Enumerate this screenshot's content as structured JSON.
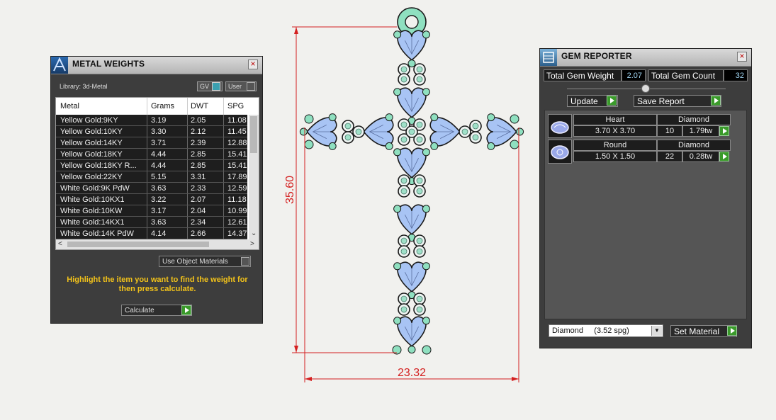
{
  "metal_weights": {
    "title": "METAL WEIGHTS",
    "library_label": "Library: 3d-Metal",
    "gv_label": "GV",
    "user_label": "User",
    "columns": [
      "Metal",
      "Grams",
      "DWT",
      "SPG"
    ],
    "rows": [
      [
        "Yellow Gold:9KY",
        "3.19",
        "2.05",
        "11.08"
      ],
      [
        "Yellow Gold:10KY",
        "3.30",
        "2.12",
        "11.45"
      ],
      [
        "Yellow Gold:14KY",
        "3.71",
        "2.39",
        "12.88"
      ],
      [
        "Yellow Gold:18KY",
        "4.44",
        "2.85",
        "15.41"
      ],
      [
        "Yellow Gold:18KY R...",
        "4.44",
        "2.85",
        "15.41"
      ],
      [
        "Yellow Gold:22KY",
        "5.15",
        "3.31",
        "17.89"
      ],
      [
        "White Gold:9K PdW",
        "3.63",
        "2.33",
        "12.59"
      ],
      [
        "White Gold:10KX1",
        "3.22",
        "2.07",
        "11.18"
      ],
      [
        "White Gold:10KW",
        "3.17",
        "2.04",
        "10.99"
      ],
      [
        "White Gold:14KX1",
        "3.63",
        "2.34",
        "12.61"
      ],
      [
        "White Gold:14K PdW",
        "4.14",
        "2.66",
        "14.37"
      ]
    ],
    "use_object_materials": "Use Object Materials",
    "hint": "Highlight the item you want to find the weight for then press calculate.",
    "calculate_label": "Calculate"
  },
  "drawing": {
    "height_label": "35.60",
    "width_label": "23.32",
    "colors": {
      "dimension": "#d42020",
      "heart_fill": "#a8c4f4",
      "accent_fill": "#8fe0c0",
      "outline": "#1a1a1a"
    }
  },
  "gem_reporter": {
    "title": "GEM REPORTER",
    "total_weight_label": "Total Gem Weight",
    "total_weight_value": "2.07",
    "total_count_label": "Total Gem Count",
    "total_count_value": "32",
    "update_label": "Update",
    "save_report_label": "Save Report",
    "gems": [
      {
        "shape": "Heart",
        "material": "Diamond",
        "size": "3.70 X 3.70",
        "count": "10",
        "weight": "1.79tw"
      },
      {
        "shape": "Round",
        "material": "Diamond",
        "size": "1.50 X 1.50",
        "count": "22",
        "weight": "0.28tw"
      }
    ],
    "material_select": "Diamond     (3.52 spg)",
    "set_material_label": "Set Material"
  }
}
